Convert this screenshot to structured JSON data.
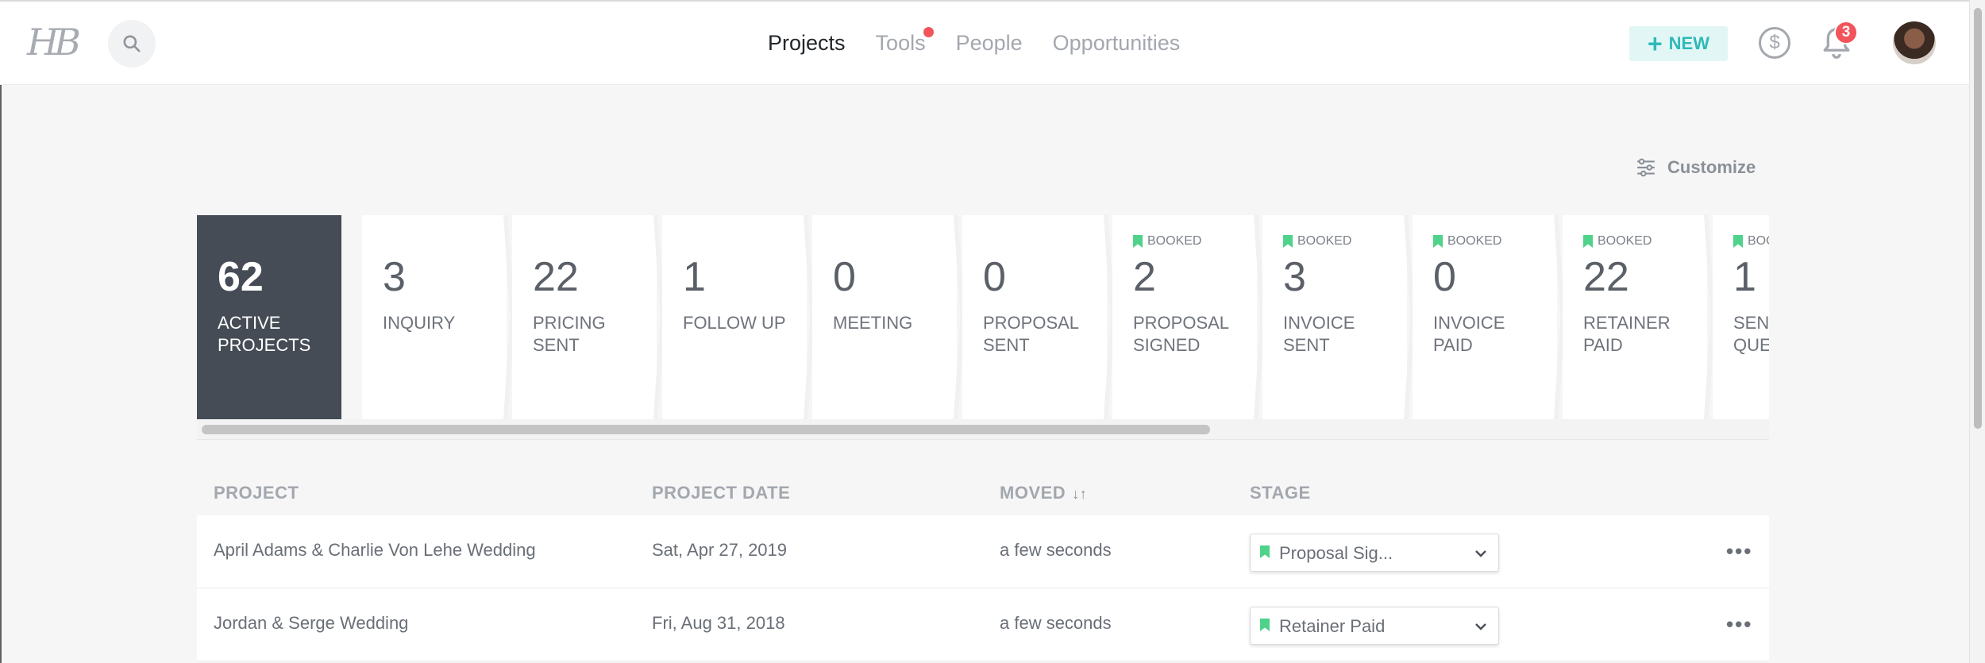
{
  "header": {
    "logo": "HB",
    "nav": [
      {
        "label": "Projects",
        "active": true
      },
      {
        "label": "Tools",
        "active": false,
        "has_dot": true
      },
      {
        "label": "People",
        "active": false
      },
      {
        "label": "Opportunities",
        "active": false
      }
    ],
    "new_button": "NEW",
    "notification_count": "3"
  },
  "customize_label": "Customize",
  "pipeline": [
    {
      "count": "62",
      "label": "ACTIVE PROJECTS",
      "active": true,
      "booked": ""
    },
    {
      "count": "3",
      "label": "INQUIRY",
      "booked": ""
    },
    {
      "count": "22",
      "label": "PRICING SENT",
      "booked": ""
    },
    {
      "count": "1",
      "label": "FOLLOW UP",
      "booked": ""
    },
    {
      "count": "0",
      "label": "MEETING",
      "booked": ""
    },
    {
      "count": "0",
      "label": "PROPOSAL SENT",
      "booked": ""
    },
    {
      "count": "2",
      "label": "PROPOSAL SIGNED",
      "booked": "BOOKED"
    },
    {
      "count": "3",
      "label": "INVOICE SENT",
      "booked": "BOOKED"
    },
    {
      "count": "0",
      "label": "INVOICE PAID",
      "booked": "BOOKED"
    },
    {
      "count": "22",
      "label": "RETAINER PAID",
      "booked": "BOOKED"
    },
    {
      "count": "1",
      "label": "SENT QUESTIONNAIRE",
      "booked": "BOOKED"
    }
  ],
  "table": {
    "columns": [
      "PROJECT",
      "PROJECT DATE",
      "MOVED",
      "STAGE"
    ],
    "rows": [
      {
        "project": "April Adams & Charlie Von Lehe Wedding",
        "date": "Sat, Apr 27, 2019",
        "moved": "a few seconds",
        "stage": "Proposal Sig..."
      },
      {
        "project": "Jordan & Serge Wedding",
        "date": "Fri, Aug 31, 2018",
        "moved": "a few seconds",
        "stage": "Retainer Paid"
      }
    ]
  },
  "colors": {
    "accent": "#2fb9b7",
    "active_card": "#454c56",
    "booked_green": "#4fd28a",
    "badge_red": "#f2545b"
  }
}
